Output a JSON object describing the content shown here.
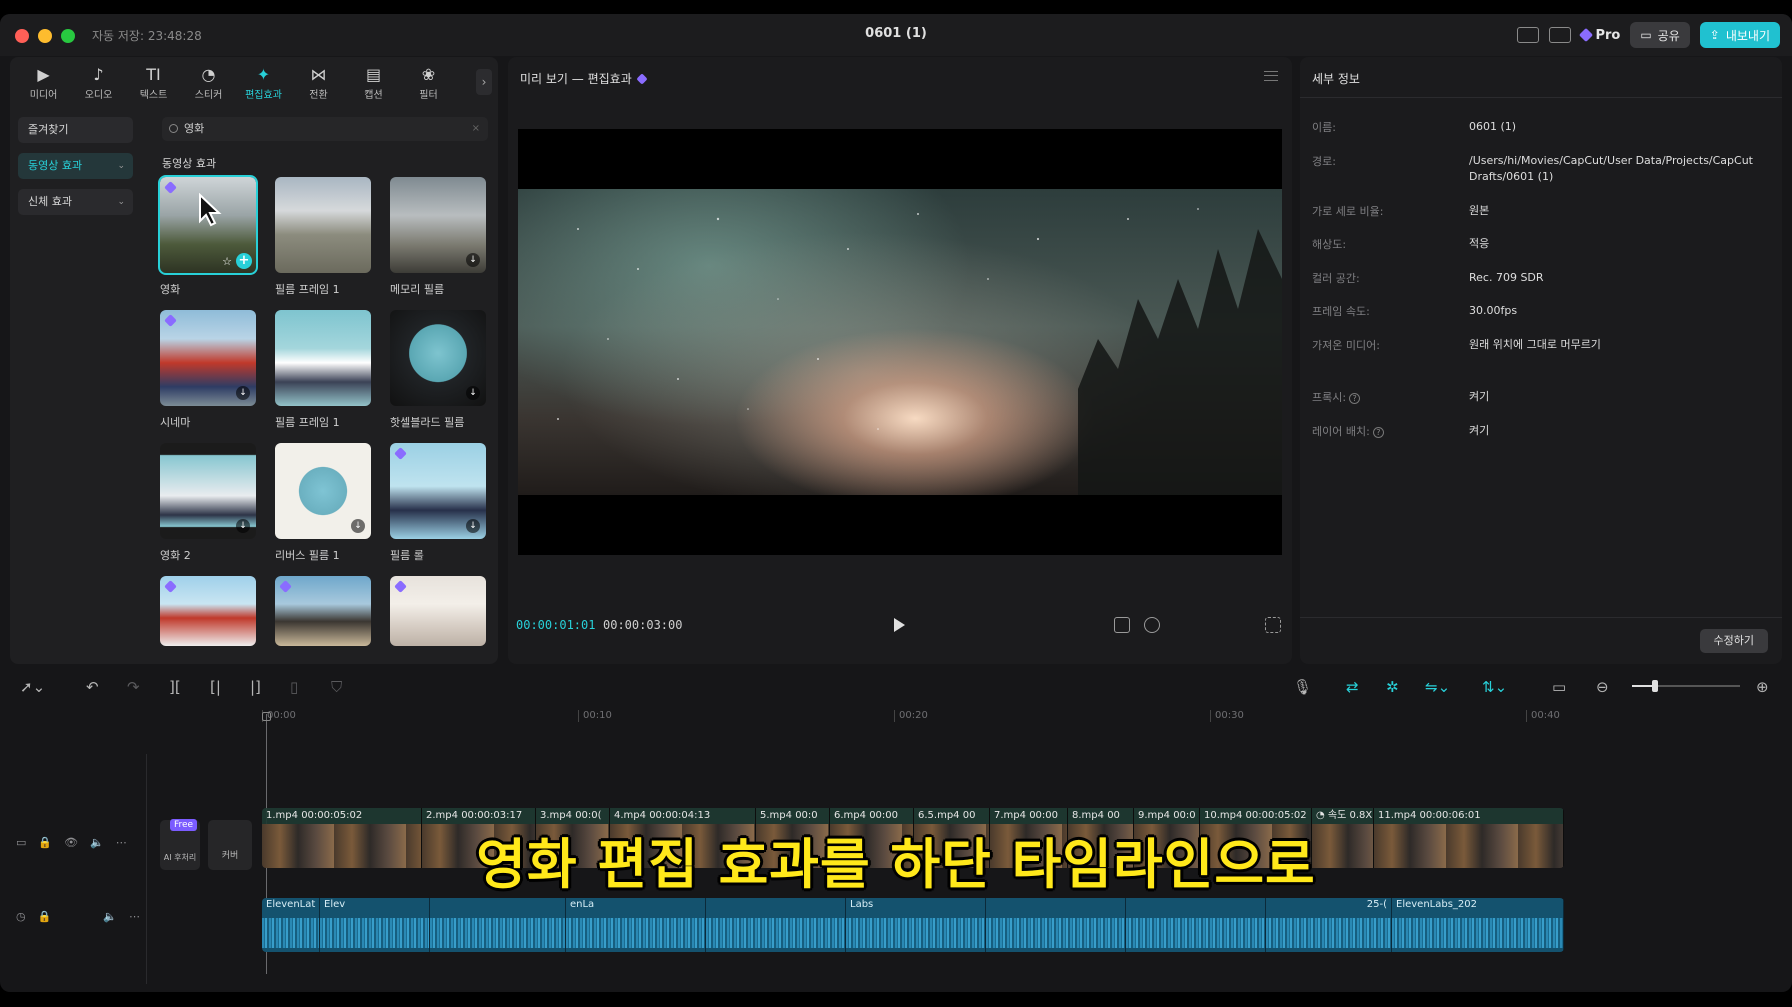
{
  "titlebar": {
    "autosave": "자동 저장: 23:48:28",
    "title": "0601 (1)",
    "pro": "Pro",
    "share": "공유",
    "export": "내보내기"
  },
  "tools": [
    {
      "label": "미디어",
      "icon": "media-icon",
      "glyph": "▶"
    },
    {
      "label": "오디오",
      "icon": "audio-icon",
      "glyph": "♪"
    },
    {
      "label": "텍스트",
      "icon": "text-icon",
      "glyph": "TI"
    },
    {
      "label": "스티커",
      "icon": "sticker-icon",
      "glyph": "◔"
    },
    {
      "label": "편집효과",
      "icon": "effects-icon",
      "glyph": "✦"
    },
    {
      "label": "전환",
      "icon": "transition-icon",
      "glyph": "⋈"
    },
    {
      "label": "캡션",
      "icon": "caption-icon",
      "glyph": "▤"
    },
    {
      "label": "필터",
      "icon": "filter-icon",
      "glyph": "❀"
    }
  ],
  "categories": {
    "favorites": "즐겨찾기",
    "video_effects": "동영상 효과",
    "body_effects": "신체 효과"
  },
  "search": {
    "value": "영화"
  },
  "section_title": "동영상 효과",
  "effects": [
    {
      "label": "영화"
    },
    {
      "label": "필름 프레임 1"
    },
    {
      "label": "메모리 필름"
    },
    {
      "label": "시네마"
    },
    {
      "label": "필름 프레임 1"
    },
    {
      "label": "핫셀블라드 필름"
    },
    {
      "label": "영화 2"
    },
    {
      "label": "리버스 필름 1"
    },
    {
      "label": "필름 롤"
    },
    {
      "label": ""
    },
    {
      "label": ""
    },
    {
      "label": ""
    }
  ],
  "preview": {
    "title": "미리 보기 — 편집효과",
    "current_time": "00:00:01:01",
    "total_time": "00:00:03:00"
  },
  "details": {
    "title": "세부 정보",
    "rows": [
      {
        "key": "이름:",
        "value": "0601 (1)"
      },
      {
        "key": "경로:",
        "value": "/Users/hi/Movies/CapCut/User Data/Projects/CapCut Drafts/0601 (1)"
      },
      {
        "key": "가로 세로 비율:",
        "value": "원본"
      },
      {
        "key": "해상도:",
        "value": "적응"
      },
      {
        "key": "컬러 공간:",
        "value": "Rec. 709 SDR"
      },
      {
        "key": "프레임 속도:",
        "value": "30.00fps"
      },
      {
        "key": "가져온 미디어:",
        "value": "원래 위치에 그대로 머무르기"
      },
      {
        "key": "프록시:",
        "value": "켜기"
      },
      {
        "key": "레이어 배치:",
        "value": "켜기"
      }
    ],
    "modify": "수정하기"
  },
  "ruler": [
    "00:00",
    "00:10",
    "00:20",
    "00:30",
    "00:40"
  ],
  "track_tools": {
    "free_tag": "Free",
    "ai_label": "AI 후처리",
    "cover": "커버"
  },
  "video_clips": [
    {
      "name": "1.mp4",
      "dur": "00:00:05:02"
    },
    {
      "name": "2.mp4",
      "dur": "00:00:03:17"
    },
    {
      "name": "3.mp4",
      "dur": "00:0("
    },
    {
      "name": "4.mp4",
      "dur": "00:00:04:13"
    },
    {
      "name": "5.mp4",
      "dur": "00:0"
    },
    {
      "name": "6.mp4",
      "dur": "00:00"
    },
    {
      "name": "6.5.mp4",
      "dur": "00"
    },
    {
      "name": "7.mp4",
      "dur": "00:00"
    },
    {
      "name": "8.mp4",
      "dur": "00"
    },
    {
      "name": "9.mp4",
      "dur": "00:0"
    },
    {
      "name": "10.mp4",
      "dur": "00:00:05:02"
    },
    {
      "name": "속도 0.8X",
      "dur": ""
    },
    {
      "name": "11.mp4",
      "dur": "00:00:06:01"
    }
  ],
  "audio_clips": [
    {
      "name": "ElevenLat"
    },
    {
      "name": "Elev"
    },
    {
      "name": ""
    },
    {
      "name": "enLa"
    },
    {
      "name": ""
    },
    {
      "name": "Labs"
    },
    {
      "name": ""
    },
    {
      "name": ""
    },
    {
      "name": "25-("
    },
    {
      "name": "ElevenLabs_202"
    }
  ],
  "subtitle": "영화 편집 효과를 하단 타임라인으로"
}
